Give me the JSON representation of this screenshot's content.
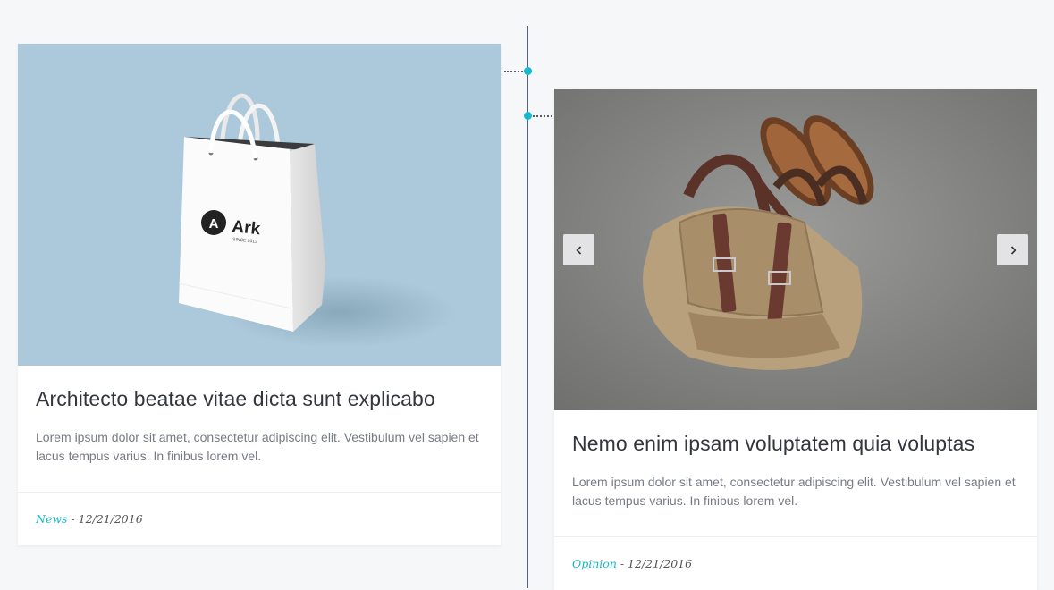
{
  "posts": [
    {
      "title": "Architecto beatae vitae dicta sunt explicabo",
      "excerpt": "Lorem ipsum dolor sit amet, consectetur adipiscing elit. Vestibulum vel sapien et lacus tempus varius. In finibus lorem vel.",
      "category": "News",
      "date": " - 12/21/2016",
      "image": {
        "label": "Ark",
        "sublabel": "SINCE 2013",
        "logo_letter": "A",
        "background": "#abc9da"
      }
    },
    {
      "title": "Nemo enim ipsam voluptatem quia voluptas",
      "excerpt": "Lorem ipsum dolor sit amet, consectetur adipiscing elit. Vestibulum vel sapien et lacus tempus varius. In finibus lorem vel.",
      "category": "Opinion",
      "date": " - 12/21/2016",
      "image": {
        "background": "#8d8e8c"
      },
      "carousel": {
        "prev_icon": "chevron-left-icon",
        "next_icon": "chevron-right-icon"
      }
    }
  ],
  "colors": {
    "accent": "#17b8c9",
    "timeline": "#5b5f72",
    "page_bg": "#f6f7f9"
  }
}
